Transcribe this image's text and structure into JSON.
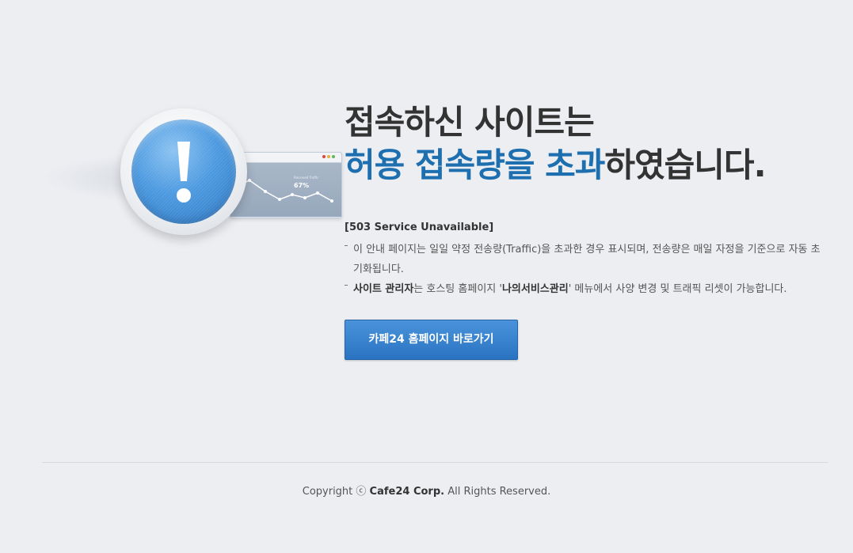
{
  "headline": {
    "line1": "접속하신 사이트는",
    "line2_accent": "허용 접속량을 초과",
    "line2_rest": "하였습니다."
  },
  "status_code": "[503 Service Unavailable]",
  "notes": [
    {
      "text": "이 안내 페이지는 일일 약정 전송량(Traffic)을 초과한 경우 표시되며, 전송량은 매일 자정을 기준으로 자동 초기화됩니다."
    },
    {
      "bold1": "사이트 관리자",
      "text1": "는 호스팅 홈페이지 '",
      "bold2": "나의서비스관리",
      "text2": "' 메뉴에서 사양 변경 및 트래픽 리셋이 가능합니다."
    }
  ],
  "cta_label": "카페24 홈페이지 바로가기",
  "illustration": {
    "browser_percent": "67%",
    "browser_caption": "Received Traffic",
    "icon": "exclamation-icon"
  },
  "footer": {
    "prefix": "Copyright ⓒ ",
    "company": "Cafe24 Corp.",
    "suffix": " All Rights Reserved."
  },
  "colors": {
    "background": "#eceef2",
    "accent": "#1e6fb0",
    "button": "#2f7dcc"
  }
}
